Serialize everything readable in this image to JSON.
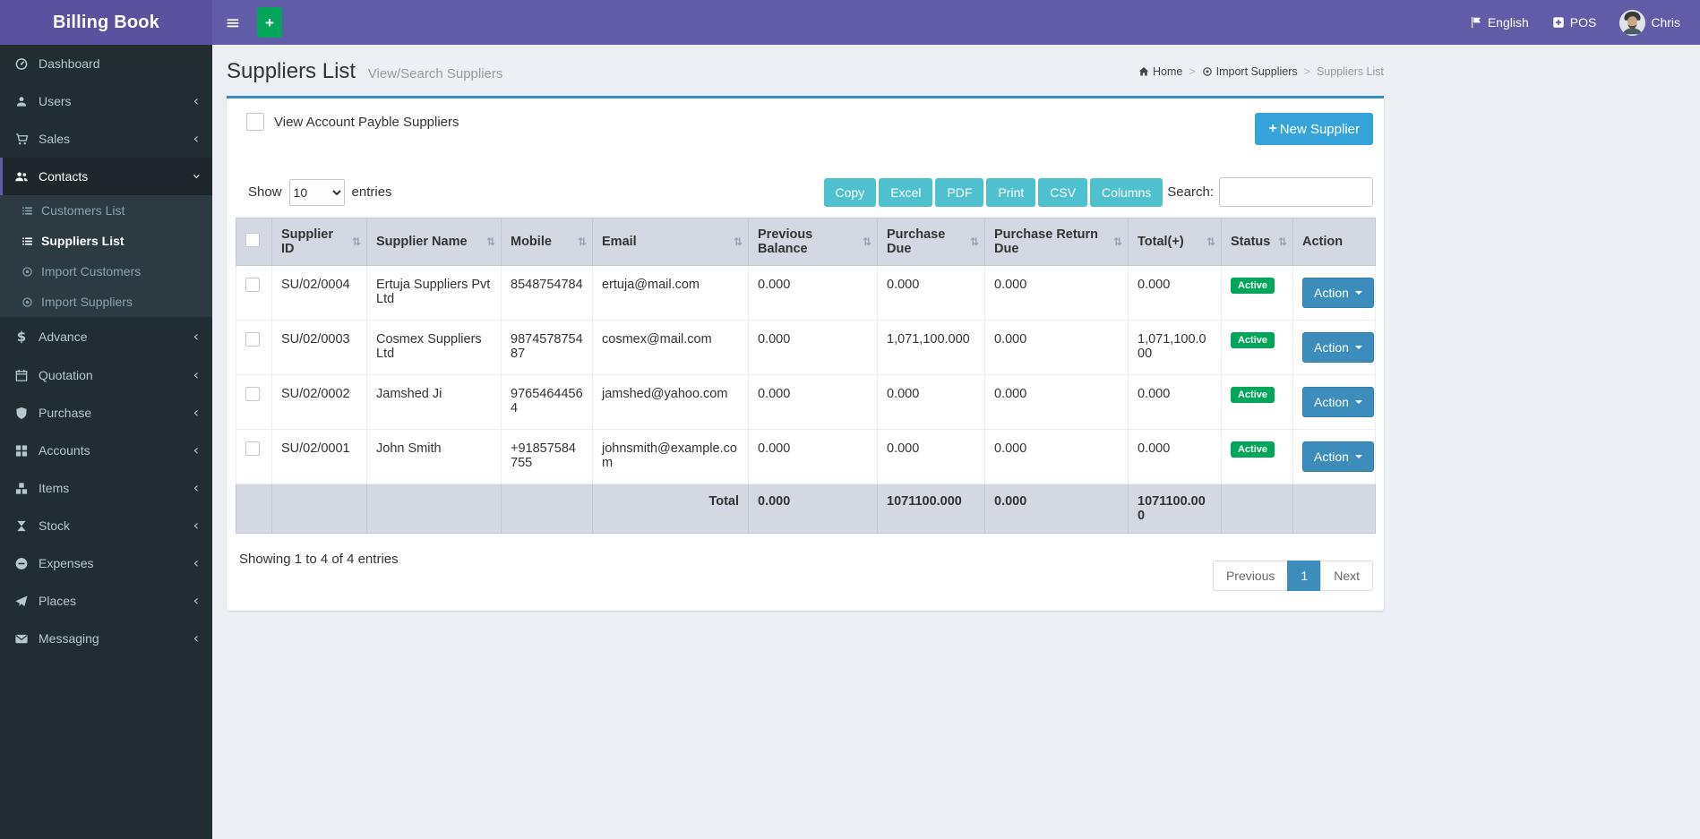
{
  "header": {
    "brand": "Billing Book",
    "language": "English",
    "pos": "POS",
    "user": "Chris"
  },
  "icons": {
    "hamburger": "≡",
    "plus": "+",
    "chevron": "‹",
    "sort": "⇅"
  },
  "sidebar": {
    "items": [
      {
        "label": "Dashboard"
      },
      {
        "label": "Users"
      },
      {
        "label": "Sales"
      },
      {
        "label": "Contacts"
      },
      {
        "label": "Advance"
      },
      {
        "label": "Quotation"
      },
      {
        "label": "Purchase"
      },
      {
        "label": "Accounts"
      },
      {
        "label": "Items"
      },
      {
        "label": "Stock"
      },
      {
        "label": "Expenses"
      },
      {
        "label": "Places"
      },
      {
        "label": "Messaging"
      }
    ],
    "contacts_submenu": [
      {
        "label": "Customers List"
      },
      {
        "label": "Suppliers List"
      },
      {
        "label": "Import Customers"
      },
      {
        "label": "Import Suppliers"
      }
    ]
  },
  "page": {
    "title": "Suppliers List",
    "subtitle": "View/Search Suppliers",
    "breadcrumb": {
      "home": "Home",
      "parent": "Import Suppliers",
      "current": "Suppliers List"
    }
  },
  "toolbar": {
    "view_payble_label": "View Account Payble Suppliers",
    "new_supplier_label": "New Supplier",
    "show_label": "Show",
    "page_length": "10",
    "entries_label": "entries",
    "export_buttons": [
      "Copy",
      "Excel",
      "PDF",
      "Print",
      "CSV",
      "Columns"
    ],
    "search_label": "Search:",
    "search_value": ""
  },
  "table": {
    "columns": [
      "Supplier ID",
      "Supplier Name",
      "Mobile",
      "Email",
      "Previous Balance",
      "Purchase Due",
      "Purchase Return Due",
      "Total(+)",
      "Status",
      "Action"
    ],
    "rows": [
      {
        "supplier_id": "SU/02/0004",
        "name": "Ertuja Suppliers Pvt Ltd",
        "mobile": "8548754784",
        "email": "ertuja@mail.com",
        "previous_balance": "0.000",
        "purchase_due": "0.000",
        "purchase_return_due": "0.000",
        "total": "0.000",
        "status": "Active",
        "action": "Action"
      },
      {
        "supplier_id": "SU/02/0003",
        "name": "Cosmex Suppliers Ltd",
        "mobile": "987457875487",
        "email": "cosmex@mail.com",
        "previous_balance": "0.000",
        "purchase_due": "1,071,100.000",
        "purchase_return_due": "0.000",
        "total": "1,071,100.000",
        "status": "Active",
        "action": "Action"
      },
      {
        "supplier_id": "SU/02/0002",
        "name": "Jamshed Ji",
        "mobile": "97654644564",
        "email": "jamshed@yahoo.com",
        "previous_balance": "0.000",
        "purchase_due": "0.000",
        "purchase_return_due": "0.000",
        "total": "0.000",
        "status": "Active",
        "action": "Action"
      },
      {
        "supplier_id": "SU/02/0001",
        "name": "John Smith",
        "mobile": "+91857584755",
        "email": "johnsmith@example.com",
        "previous_balance": "0.000",
        "purchase_due": "0.000",
        "purchase_return_due": "0.000",
        "total": "0.000",
        "status": "Active",
        "action": "Action"
      }
    ],
    "footer": {
      "label": "Total",
      "previous_balance": "0.000",
      "purchase_due": "1071100.000",
      "purchase_return_due": "0.000",
      "total": "1071100.000"
    },
    "info": "Showing 1 to 4 of 4 entries"
  },
  "pagination": {
    "previous": "Previous",
    "current": "1",
    "next": "Next"
  },
  "colors": {
    "navbar_purple": "#605ca8",
    "sidebar_dark": "#222d32",
    "accent_blue": "#3c8dbc",
    "success_green": "#00a65a",
    "export_teal": "#4fc0ce",
    "info_blue": "#36a3db"
  }
}
